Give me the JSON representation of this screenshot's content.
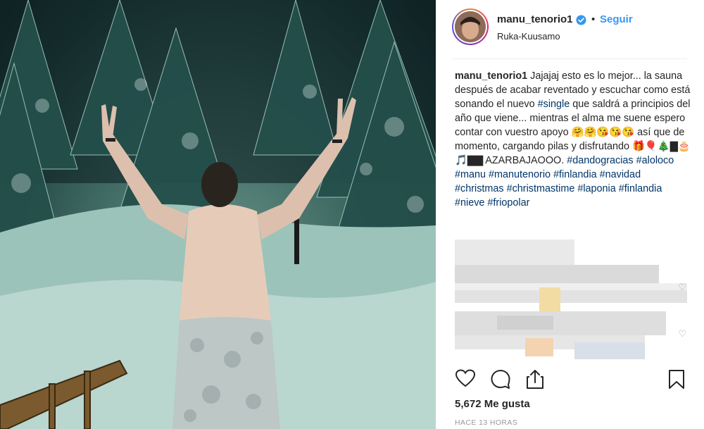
{
  "post": {
    "username": "manu_tenorio1",
    "follow_label": "Seguir",
    "separator": "•",
    "location": "Ruka-Kuusamo",
    "caption": {
      "user": "manu_tenorio1",
      "segments": [
        {
          "t": "text",
          "v": "Jajajaj esto es lo mejor... la sauna después de acabar reventado y escuchar como está sonando el nuevo "
        },
        {
          "t": "tag",
          "v": "#single"
        },
        {
          "t": "text",
          "v": " que saldrá a principios del año que viene... mientras el alma me suene espero contar con vuestro apoyo 🤗🤗😘😘😘 así que de momento, cargando pilas y disfrutando 🎁🎈🎄▇🎂🎵▇▇ AZARBAJAOOO. "
        },
        {
          "t": "tag",
          "v": "#dandogracias"
        },
        {
          "t": "text",
          "v": " "
        },
        {
          "t": "tag",
          "v": "#aloloco"
        },
        {
          "t": "text",
          "v": " "
        },
        {
          "t": "tag",
          "v": "#manu"
        },
        {
          "t": "text",
          "v": " "
        },
        {
          "t": "tag",
          "v": "#manutenorio"
        },
        {
          "t": "text",
          "v": " "
        },
        {
          "t": "tag",
          "v": "#finlandia"
        },
        {
          "t": "text",
          "v": " "
        },
        {
          "t": "tag",
          "v": "#navidad"
        },
        {
          "t": "text",
          "v": " "
        },
        {
          "t": "tag",
          "v": "#christmas"
        },
        {
          "t": "text",
          "v": " "
        },
        {
          "t": "tag",
          "v": "#christmastime"
        },
        {
          "t": "text",
          "v": " "
        },
        {
          "t": "tag",
          "v": "#laponia"
        },
        {
          "t": "text",
          "v": " "
        },
        {
          "t": "tag",
          "v": "#finlandia"
        },
        {
          "t": "text",
          "v": " "
        },
        {
          "t": "tag",
          "v": "#nieve"
        },
        {
          "t": "text",
          "v": " "
        },
        {
          "t": "tag",
          "v": "#friopolar"
        }
      ]
    },
    "likes_label": "5,672 Me gusta",
    "time_label": "HACE 13 HORAS",
    "icons": {
      "like": "heart-icon",
      "comment": "comment-icon",
      "share": "share-icon",
      "save": "bookmark-icon",
      "verified": "verified-badge-icon"
    },
    "colors": {
      "link": "#3897f0",
      "hashtag": "#003569",
      "text": "#262626",
      "muted": "#999999"
    }
  }
}
